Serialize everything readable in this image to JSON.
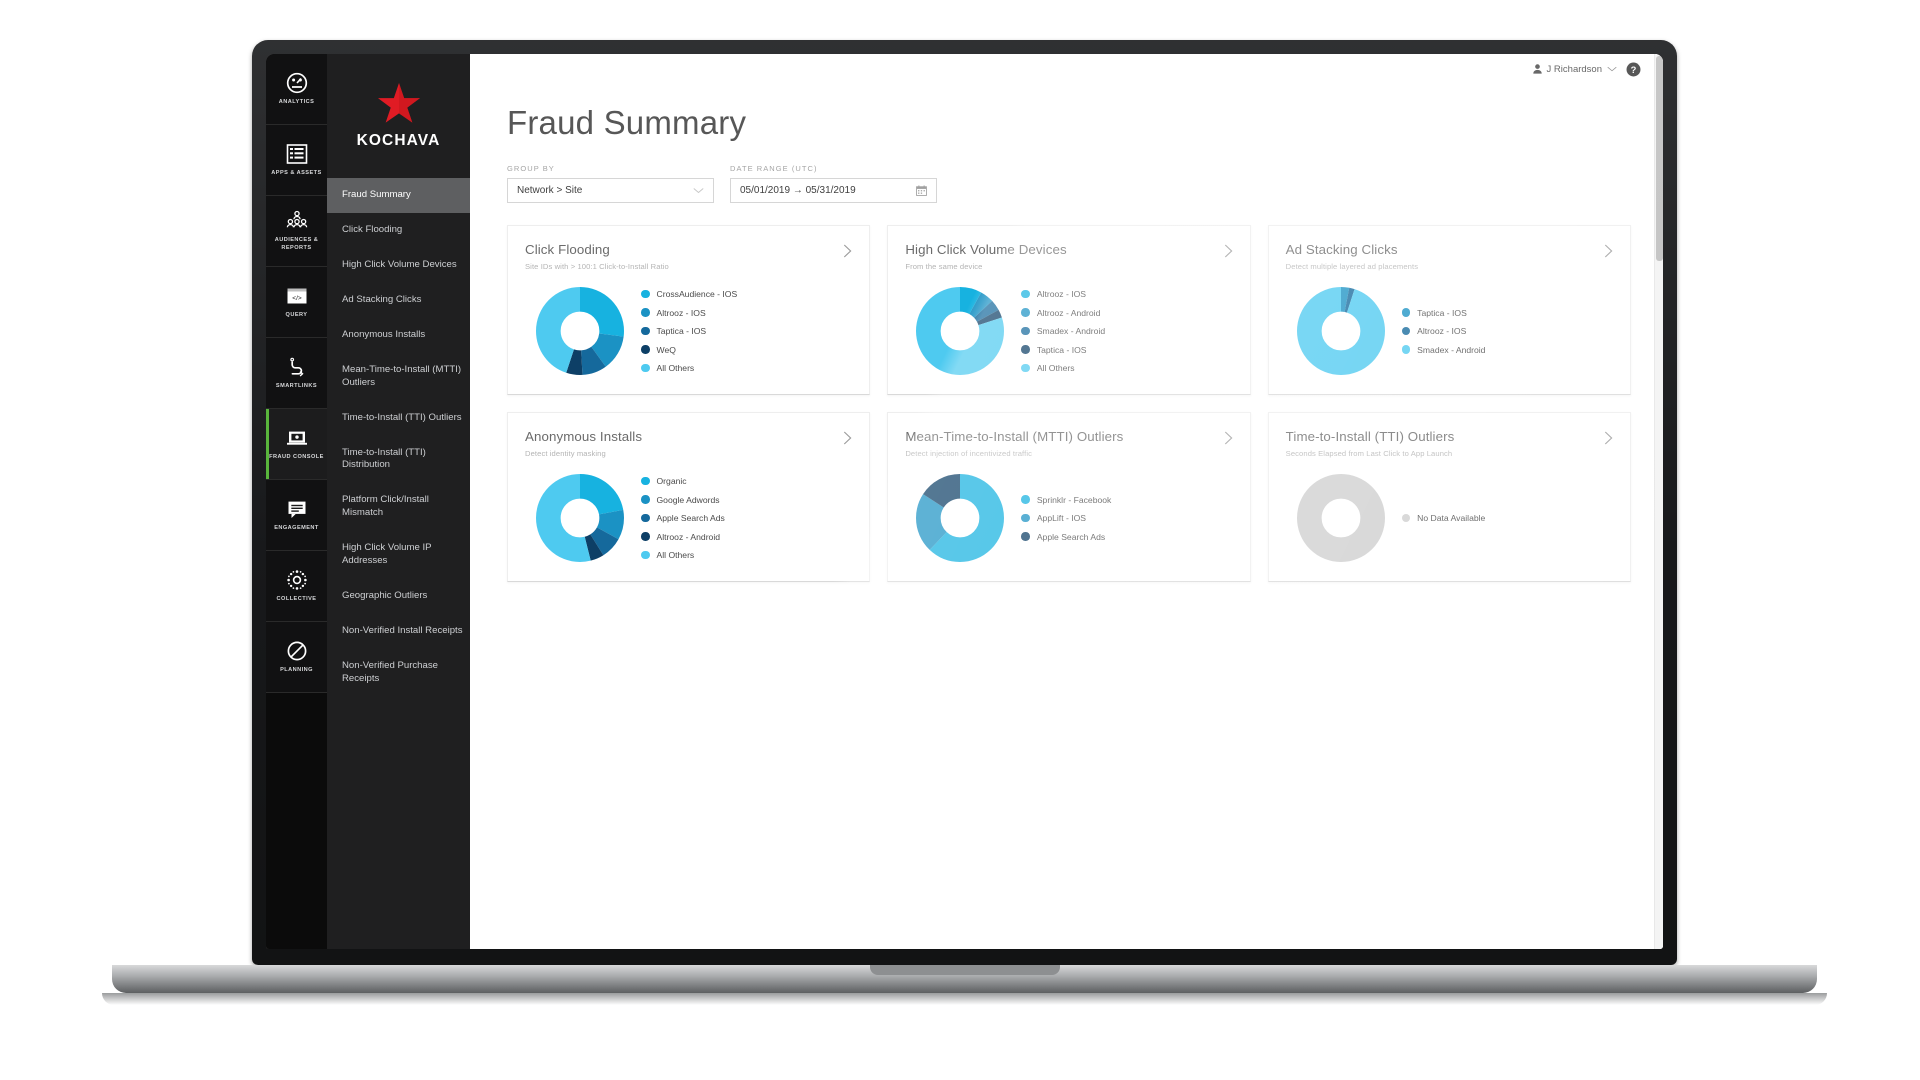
{
  "window": {
    "chrome_bg": "#1f1f20"
  },
  "rail": {
    "items": [
      {
        "label": "Analytics",
        "icon": "dashboard-gauge-icon",
        "active": false
      },
      {
        "label": "Apps & Assets",
        "icon": "list-icon",
        "active": false
      },
      {
        "label": "Audiences & Reports",
        "icon": "people-icon",
        "active": false
      },
      {
        "label": "Query",
        "icon": "code-window-icon",
        "active": false
      },
      {
        "label": "SmartLinks",
        "icon": "link-path-icon",
        "active": false
      },
      {
        "label": "Fraud Console",
        "icon": "laptop-icon",
        "active": true
      },
      {
        "label": "Engagement",
        "icon": "message-icon",
        "active": false
      },
      {
        "label": "Collective",
        "icon": "network-dots-icon",
        "active": false
      },
      {
        "label": "Planning",
        "icon": "no-entry-icon",
        "active": false
      }
    ]
  },
  "brand": {
    "name": "KOCHAVA",
    "logo_color": "#e01b24"
  },
  "subnav": {
    "items": [
      {
        "label": "Fraud Summary",
        "active": true
      },
      {
        "label": "Click Flooding",
        "active": false
      },
      {
        "label": "High Click Volume Devices",
        "active": false
      },
      {
        "label": "Ad Stacking Clicks",
        "active": false
      },
      {
        "label": "Anonymous Installs",
        "active": false
      },
      {
        "label": "Mean-Time-to-Install (MTTI) Outliers",
        "active": false
      },
      {
        "label": "Time-to-Install (TTI) Outliers",
        "active": false
      },
      {
        "label": "Time-to-Install (TTI) Distribution",
        "active": false
      },
      {
        "label": "Platform Click/Install Mismatch",
        "active": false
      },
      {
        "label": "High Click Volume IP Addresses",
        "active": false
      },
      {
        "label": "Geographic Outliers",
        "active": false
      },
      {
        "label": "Non-Verified Install Receipts",
        "active": false
      },
      {
        "label": "Non-Verified Purchase Receipts",
        "active": false
      }
    ]
  },
  "topbar": {
    "user_name": "J Richardson",
    "user_icon": "person-icon",
    "chevron_icon": "chevron-down-icon",
    "help_icon": "help-question-icon"
  },
  "page": {
    "title": "Fraud Summary"
  },
  "filters": {
    "group_by": {
      "label": "Group By",
      "value": "Network > Site",
      "chevron_icon": "chevron-down-icon"
    },
    "date_range": {
      "label": "Date Range (UTC)",
      "value": "05/01/2019 → 05/31/2019",
      "calendar_icon": "calendar-icon"
    }
  },
  "palette": {
    "c1": "#4ecaf0",
    "c2": "#17b2e0",
    "c3": "#1b92c4",
    "c4": "#15699c",
    "c5": "#0d3f66",
    "empty": "#cfcfcf"
  },
  "chart_data": [
    {
      "type": "pie",
      "title": "Click Flooding",
      "subtitle": "Site IDs with > 100:1 Click-to-Install Ratio",
      "arrow_icon": "chevron-right-icon",
      "labels": [
        "CrossAudience - IOS",
        "Altrooz - IOS",
        "Taptica - IOS",
        "WeQ",
        "All Others"
      ],
      "values": [
        27,
        13,
        9,
        6,
        45
      ],
      "colors": [
        "#17b2e0",
        "#1b92c4",
        "#15699c",
        "#0d3f66",
        "#4ecaf0"
      ],
      "legend_position": "right",
      "no_data": false
    },
    {
      "type": "pie",
      "title": "High Click Volume Devices",
      "subtitle": "From the same device",
      "arrow_icon": "chevron-right-icon",
      "labels": [
        "Altrooz - IOS",
        "Altrooz - Android",
        "Smadex - Android",
        "Taptica - IOS",
        "All Others"
      ],
      "values": [
        8,
        5,
        4,
        3,
        80
      ],
      "colors": [
        "#17b2e0",
        "#1b92c4",
        "#15699c",
        "#0d3f66",
        "#4ecaf0"
      ],
      "legend_position": "right",
      "no_data": false
    },
    {
      "type": "pie",
      "title": "Ad Stacking Clicks",
      "subtitle": "Detect multiple layered ad placements",
      "arrow_icon": "chevron-right-icon",
      "labels": [
        "Taptica - IOS",
        "Altrooz - IOS",
        "Smadex - Android"
      ],
      "values": [
        3,
        2,
        95
      ],
      "colors": [
        "#1b92c4",
        "#15699c",
        "#4ecaf0"
      ],
      "legend_position": "right",
      "no_data": false
    },
    {
      "type": "pie",
      "title": "Anonymous Installs",
      "subtitle": "Detect identity masking",
      "arrow_icon": "chevron-right-icon",
      "labels": [
        "Organic",
        "Google Adwords",
        "Apple Search Ads",
        "Altrooz - Android",
        "All Others"
      ],
      "values": [
        22,
        11,
        8,
        5,
        54
      ],
      "colors": [
        "#17b2e0",
        "#1b92c4",
        "#15699c",
        "#0d3f66",
        "#4ecaf0"
      ],
      "legend_position": "right",
      "no_data": false
    },
    {
      "type": "pie",
      "title": "Mean-Time-to-Install (MTTI) Outliers",
      "subtitle": "Detect injection of incentivized traffic",
      "arrow_icon": "chevron-right-icon",
      "labels": [
        "Sprinklr - Facebook",
        "AppLift - IOS",
        "Apple Search Ads"
      ],
      "values": [
        62,
        22,
        16
      ],
      "colors": [
        "#17b2e0",
        "#1b92c4",
        "#0d3f66"
      ],
      "legend_position": "right",
      "no_data": false
    },
    {
      "type": "pie",
      "title": "Time-to-Install (TTI) Outliers",
      "subtitle": "Seconds Elapsed from Last Click to App Launch",
      "arrow_icon": "chevron-right-icon",
      "labels": [
        "No Data Available"
      ],
      "values": [
        100
      ],
      "colors": [
        "#cfcfcf"
      ],
      "legend_position": "right",
      "no_data": true
    }
  ]
}
